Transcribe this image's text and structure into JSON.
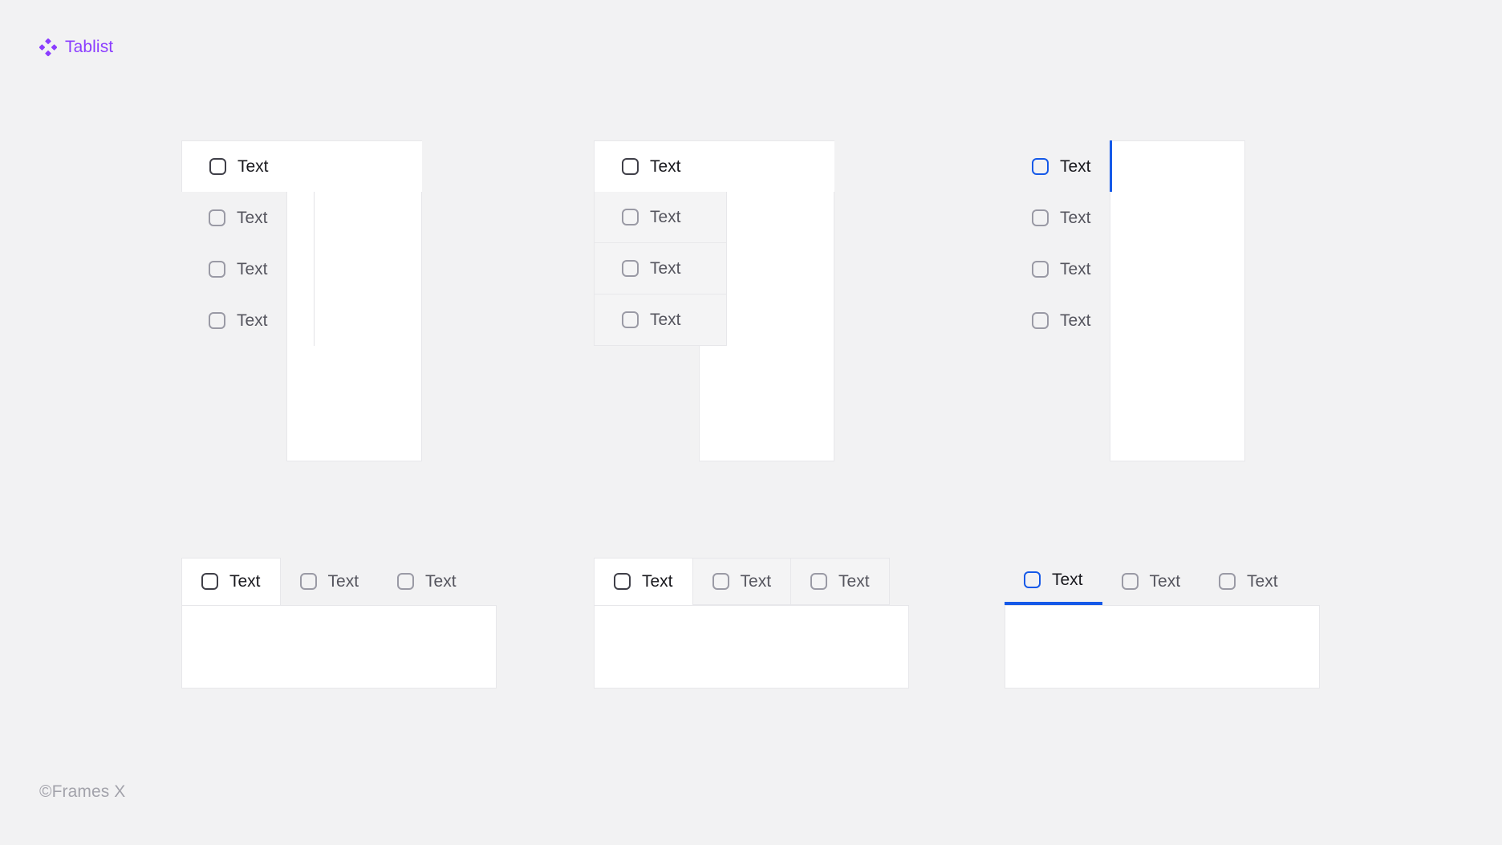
{
  "brand": {
    "name": "Tablist",
    "icon": "four-diamond-logo-icon",
    "color": "#8b3dff"
  },
  "footer": {
    "text": "©Frames X"
  },
  "theme": {
    "background": "#f2f2f3",
    "surface": "#ffffff",
    "border": "#e7e7ea",
    "muted_surface": "#f4f4f5",
    "text_active": "#18181d",
    "text_inactive": "#55555e",
    "checkbox_inactive": "#9a9aa5",
    "checkbox_active_dark": "#3f3f48",
    "accent_blue": "#1559e8"
  },
  "groups": [
    {
      "id": "vertical-plain",
      "orientation": "vertical",
      "variant": "plain",
      "tabs": [
        {
          "label": "Text",
          "active": true,
          "icon": "checkbox-icon"
        },
        {
          "label": "Text",
          "active": false,
          "icon": "checkbox-icon"
        },
        {
          "label": "Text",
          "active": false,
          "icon": "checkbox-icon"
        },
        {
          "label": "Text",
          "active": false,
          "icon": "checkbox-icon"
        }
      ],
      "panel": {
        "content": ""
      }
    },
    {
      "id": "vertical-bordered",
      "orientation": "vertical",
      "variant": "bordered",
      "tabs": [
        {
          "label": "Text",
          "active": true,
          "icon": "checkbox-icon"
        },
        {
          "label": "Text",
          "active": false,
          "icon": "checkbox-icon"
        },
        {
          "label": "Text",
          "active": false,
          "icon": "checkbox-icon"
        },
        {
          "label": "Text",
          "active": false,
          "icon": "checkbox-icon"
        }
      ],
      "panel": {
        "content": ""
      }
    },
    {
      "id": "vertical-accent",
      "orientation": "vertical",
      "variant": "accent-indicator",
      "tabs": [
        {
          "label": "Text",
          "active": true,
          "icon": "checkbox-icon"
        },
        {
          "label": "Text",
          "active": false,
          "icon": "checkbox-icon"
        },
        {
          "label": "Text",
          "active": false,
          "icon": "checkbox-icon"
        },
        {
          "label": "Text",
          "active": false,
          "icon": "checkbox-icon"
        }
      ],
      "panel": {
        "content": ""
      }
    },
    {
      "id": "horizontal-plain",
      "orientation": "horizontal",
      "variant": "plain",
      "tabs": [
        {
          "label": "Text",
          "active": true,
          "icon": "checkbox-icon"
        },
        {
          "label": "Text",
          "active": false,
          "icon": "checkbox-icon"
        },
        {
          "label": "Text",
          "active": false,
          "icon": "checkbox-icon"
        }
      ],
      "panel": {
        "content": ""
      }
    },
    {
      "id": "horizontal-bordered",
      "orientation": "horizontal",
      "variant": "bordered",
      "tabs": [
        {
          "label": "Text",
          "active": true,
          "icon": "checkbox-icon"
        },
        {
          "label": "Text",
          "active": false,
          "icon": "checkbox-icon"
        },
        {
          "label": "Text",
          "active": false,
          "icon": "checkbox-icon"
        }
      ],
      "panel": {
        "content": ""
      }
    },
    {
      "id": "horizontal-accent",
      "orientation": "horizontal",
      "variant": "accent-underline",
      "tabs": [
        {
          "label": "Text",
          "active": true,
          "icon": "checkbox-icon"
        },
        {
          "label": "Text",
          "active": false,
          "icon": "checkbox-icon"
        },
        {
          "label": "Text",
          "active": false,
          "icon": "checkbox-icon"
        }
      ],
      "panel": {
        "content": ""
      }
    }
  ]
}
